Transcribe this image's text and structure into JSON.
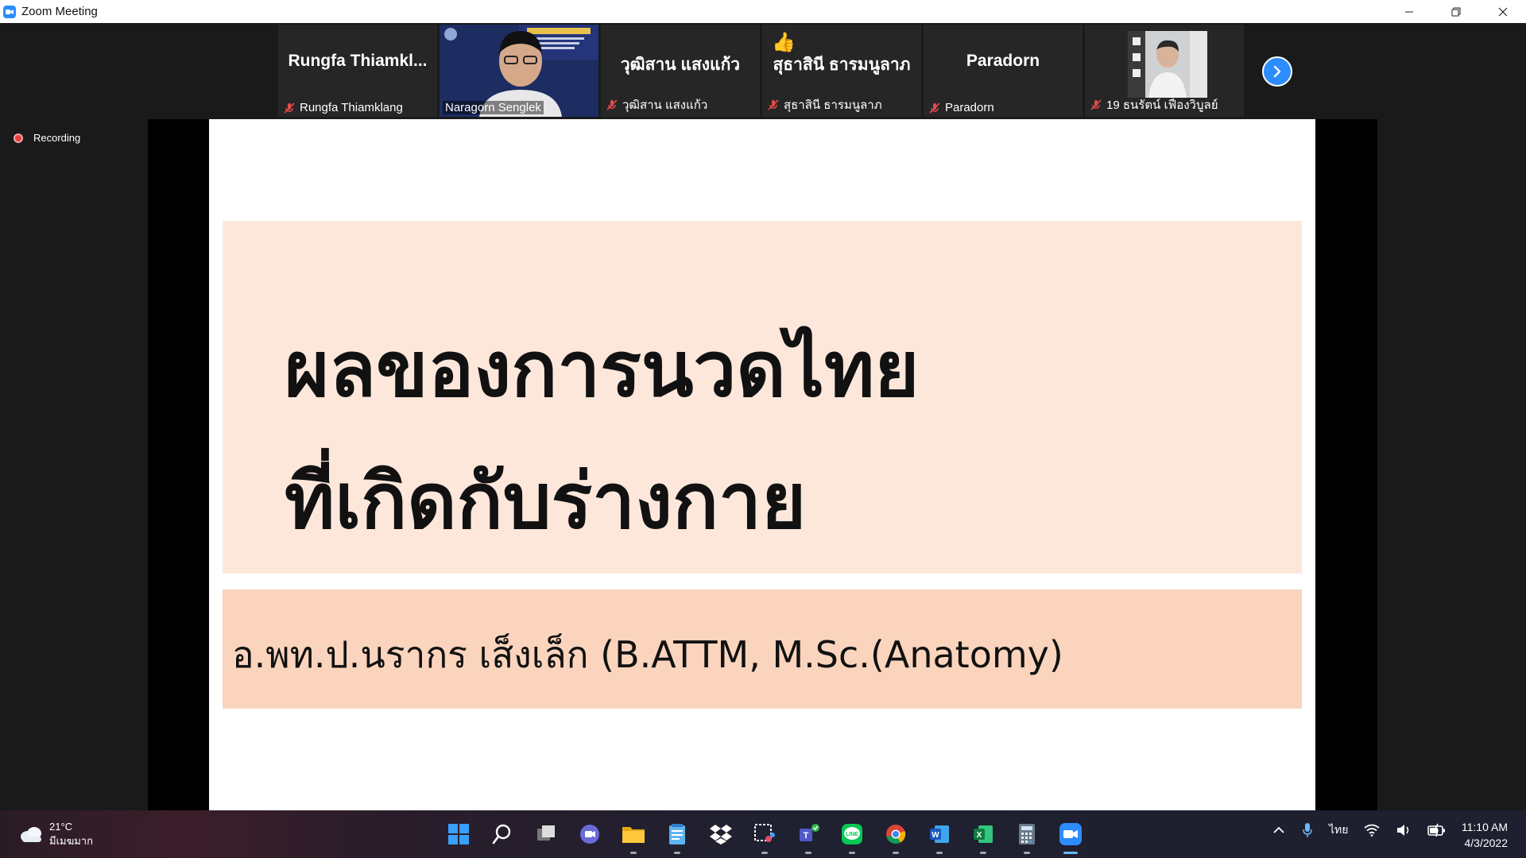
{
  "window": {
    "title": "Zoom Meeting"
  },
  "participants": [
    {
      "display_name": "Rungfa  Thiamkl...",
      "label": "Rungfa Thiamklang",
      "muted": true,
      "video": false
    },
    {
      "display_name": "",
      "label": "Naragorn Senglek",
      "muted": false,
      "video": true,
      "active_speaker": true
    },
    {
      "display_name": "วุฒิสาน แสงแก้ว",
      "label": "วุฒิสาน แสงแก้ว",
      "muted": true,
      "video": false
    },
    {
      "display_name": "สุธาสินี ธารมนูลาภ",
      "label": "สุธาสินี ธารมนูลาภ",
      "muted": true,
      "video": false,
      "reaction": "thumbs-up"
    },
    {
      "display_name": "Paradorn",
      "label": "Paradorn",
      "muted": true,
      "video": false
    },
    {
      "display_name": "",
      "label": "19 ธนรัตน์ เฟื่องวิบูลย์",
      "muted": true,
      "video": true
    }
  ],
  "recording": {
    "label": "Recording"
  },
  "slide": {
    "title_line1": "ผลของการนวดไทย",
    "title_line2": "ที่เกิดกับร่างกาย",
    "subtitle": "อ.พท.ป.นรากร เส็งเล็ก (B.ATTM, M.Sc.(Anatomy)"
  },
  "taskbar": {
    "weather": {
      "temp": "21°C",
      "condition": "มีเมฆมาก"
    },
    "language": "ไทย",
    "clock": {
      "time": "11:10 AM",
      "date": "4/3/2022"
    }
  },
  "colors": {
    "zoom_blue": "#2d8cff",
    "active_speaker": "#7bd65a",
    "muted_red": "#e34b4b",
    "slide_title_bg": "#fde7db",
    "slide_sub_bg": "#fbd4bd"
  }
}
